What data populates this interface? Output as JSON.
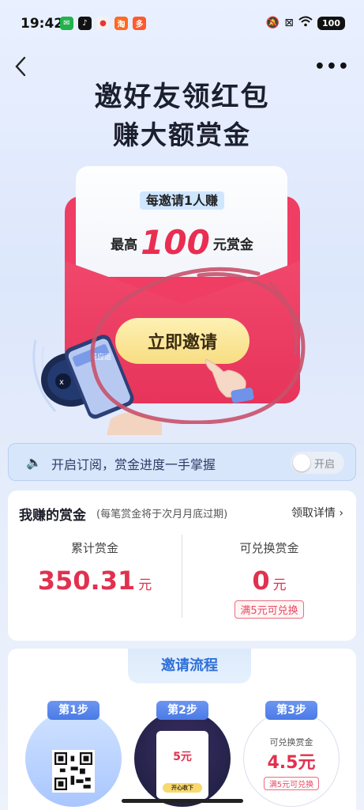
{
  "status_bar": {
    "time": "19:42",
    "battery": "100"
  },
  "hero": {
    "title_line1": "邀好友领红包",
    "title_line2": "赚大额赏金",
    "tag": "每邀请1人赚",
    "max_prefix": "最高",
    "max_amount": "100",
    "max_suffix": "元赏金",
    "invite_button": "立即邀请",
    "phone_chip": "猫应运"
  },
  "subscribe": {
    "text": "开启订阅，赏金进度一手掌握",
    "toggle_label": "开启"
  },
  "earnings": {
    "title": "我赚的赏金",
    "note": "(每笔赏金将于次月月底过期)",
    "detail_link": "领取详情",
    "total_label": "累计赏金",
    "total_value": "350.31",
    "total_unit": "元",
    "redeemable_label": "可兑换赏金",
    "redeemable_value": "0",
    "redeemable_unit": "元",
    "redeem_badge": "满5元可兑换"
  },
  "flow": {
    "title": "邀请流程",
    "steps": [
      {
        "label": "第1步"
      },
      {
        "label": "第2步",
        "amount": "5元",
        "button": "开心收下"
      },
      {
        "label": "第3步",
        "caption": "可兑换赏金",
        "value": "4.5元",
        "badge": "满5元可兑换"
      }
    ]
  },
  "colors": {
    "accent_red": "#e1314f",
    "envelope_red": "#ef3d63",
    "button_gold": "#f8dd82",
    "flow_blue": "#2e6fd9"
  }
}
